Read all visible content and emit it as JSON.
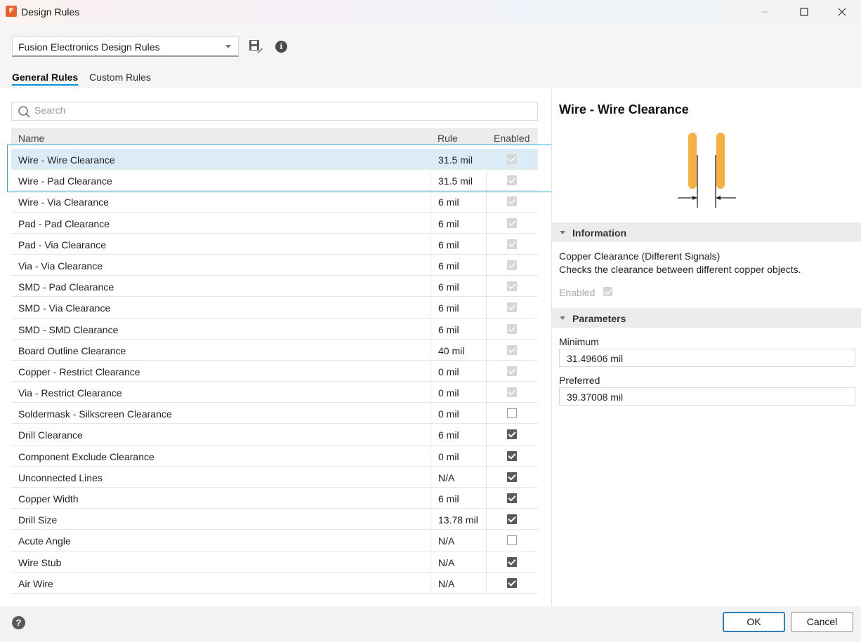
{
  "window": {
    "title": "Design Rules",
    "logo_text": "F"
  },
  "toolbar": {
    "ruleset": "Fusion Electronics Design Rules"
  },
  "tabs": [
    {
      "label": "General Rules",
      "active": true
    },
    {
      "label": "Custom Rules",
      "active": false
    }
  ],
  "search": {
    "placeholder": "Search",
    "value": ""
  },
  "table": {
    "headers": {
      "name": "Name",
      "rule": "Rule",
      "enabled": "Enabled"
    },
    "rows": [
      {
        "name": "Wire - Wire Clearance",
        "rule": "31.5 mil",
        "enabled": "disabled-checked",
        "selected": true
      },
      {
        "name": "Wire - Pad Clearance",
        "rule": "31.5 mil",
        "enabled": "disabled-checked"
      },
      {
        "name": "Wire - Via Clearance",
        "rule": "6 mil",
        "enabled": "disabled-checked"
      },
      {
        "name": "Pad - Pad Clearance",
        "rule": "6 mil",
        "enabled": "disabled-checked"
      },
      {
        "name": "Pad - Via Clearance",
        "rule": "6 mil",
        "enabled": "disabled-checked"
      },
      {
        "name": "Via - Via Clearance",
        "rule": "6 mil",
        "enabled": "disabled-checked"
      },
      {
        "name": "SMD - Pad Clearance",
        "rule": "6 mil",
        "enabled": "disabled-checked"
      },
      {
        "name": "SMD - Via Clearance",
        "rule": "6 mil",
        "enabled": "disabled-checked"
      },
      {
        "name": "SMD - SMD Clearance",
        "rule": "6 mil",
        "enabled": "disabled-checked"
      },
      {
        "name": "Board Outline Clearance",
        "rule": "40 mil",
        "enabled": "disabled-checked"
      },
      {
        "name": "Copper - Restrict Clearance",
        "rule": "0 mil",
        "enabled": "disabled-checked"
      },
      {
        "name": "Via - Restrict Clearance",
        "rule": "0 mil",
        "enabled": "disabled-checked"
      },
      {
        "name": "Soldermask - Silkscreen Clearance",
        "rule": "0 mil",
        "enabled": "unchecked"
      },
      {
        "name": "Drill Clearance",
        "rule": "6 mil",
        "enabled": "checked"
      },
      {
        "name": "Component Exclude Clearance",
        "rule": "0 mil",
        "enabled": "checked"
      },
      {
        "name": "Unconnected Lines",
        "rule": "N/A",
        "enabled": "checked"
      },
      {
        "name": "Copper Width",
        "rule": "6 mil",
        "enabled": "checked"
      },
      {
        "name": "Drill Size",
        "rule": "13.78 mil",
        "enabled": "checked"
      },
      {
        "name": "Acute Angle",
        "rule": "N/A",
        "enabled": "unchecked"
      },
      {
        "name": "Wire Stub",
        "rule": "N/A",
        "enabled": "checked"
      },
      {
        "name": "Air Wire",
        "rule": "N/A",
        "enabled": "checked"
      }
    ]
  },
  "detail": {
    "title": "Wire - Wire Clearance",
    "information_header": "Information",
    "info_title": "Copper Clearance (Different Signals)",
    "info_description": "Checks the clearance between different copper objects.",
    "enabled_label": "Enabled",
    "parameters_header": "Parameters",
    "minimum_label": "Minimum",
    "minimum_value": "31.49606 mil",
    "preferred_label": "Preferred",
    "preferred_value": "39.37008 mil",
    "diagram_color": "#f5b041"
  },
  "footer": {
    "ok_label": "OK",
    "cancel_label": "Cancel"
  },
  "colors": {
    "accent": "#0696d7",
    "selection": "#dcecf6",
    "highlight": "#2aa7d8"
  }
}
